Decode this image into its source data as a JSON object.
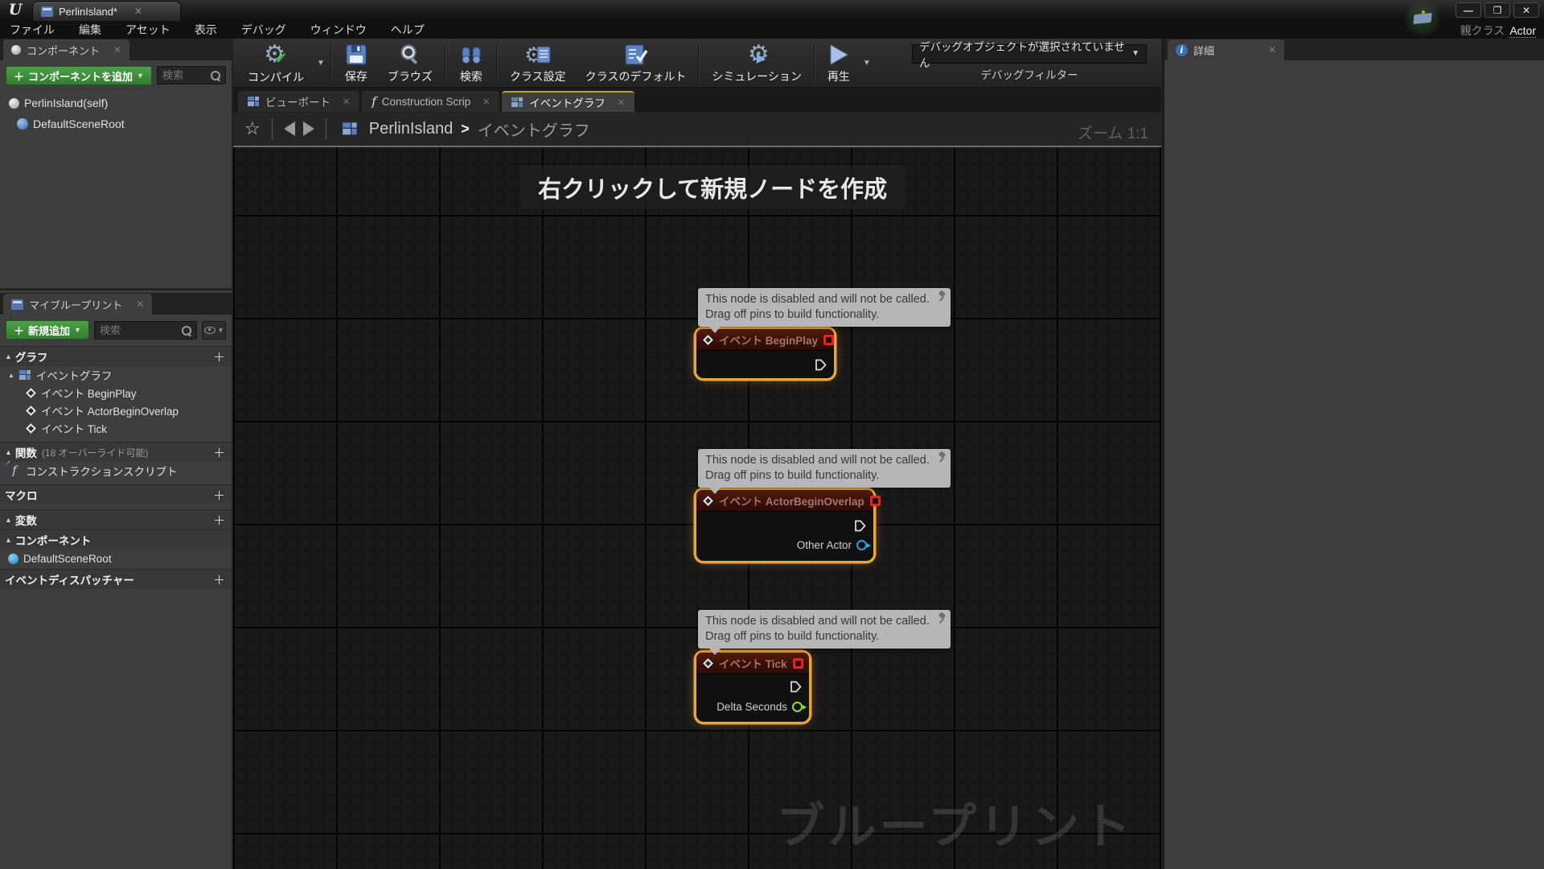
{
  "window": {
    "tab_title": "PerlinIsland*",
    "logo_glyph": "U"
  },
  "menu": {
    "items": [
      "ファイル",
      "編集",
      "アセット",
      "表示",
      "デバッグ",
      "ウィンドウ",
      "ヘルプ"
    ],
    "parent_class_label": "親クラス",
    "parent_class_value": "Actor"
  },
  "components_panel": {
    "tab_label": "コンポーネント",
    "add_button_label": "コンポーネントを追加",
    "search_placeholder": "検索",
    "items": [
      {
        "label": "PerlinIsland(self)"
      },
      {
        "label": "DefaultSceneRoot"
      }
    ]
  },
  "my_blueprint": {
    "tab_label": "マイブループリント",
    "add_button_label": "新規追加",
    "search_placeholder": "検索",
    "rows": {
      "graph_header": "グラフ",
      "event_graph": "イベントグラフ",
      "events": [
        "イベント BeginPlay",
        "イベント ActorBeginOverlap",
        "イベント Tick"
      ],
      "functions_header": "関数",
      "functions_note": "(18 オーバーライド可能)",
      "construction_script": "コンストラクションスクリプト",
      "macro_header": "マクロ",
      "variables_header": "変数",
      "components_header": "コンポーネント",
      "component_item": "DefaultSceneRoot",
      "dispatchers_header": "イベントディスパッチャー"
    }
  },
  "toolbar": {
    "buttons": [
      {
        "label": "コンパイル"
      },
      {
        "label": "保存"
      },
      {
        "label": "ブラウズ"
      },
      {
        "label": "検索"
      },
      {
        "label": "クラス設定"
      },
      {
        "label": "クラスのデフォルト"
      },
      {
        "label": "シミュレーション"
      },
      {
        "label": "再生"
      }
    ],
    "debug_dropdown_value": "デバッグオブジェクトが選択されていません",
    "debug_filter_label": "デバッグフィルター"
  },
  "doc_tabs": [
    {
      "label": "ビューポート"
    },
    {
      "label": "Construction Scrip"
    },
    {
      "label": "イベントグラフ"
    }
  ],
  "breadcrumb": {
    "root": "PerlinIsland",
    "separator": ">",
    "current": "イベントグラフ"
  },
  "graph": {
    "zoom_label": "ズーム 1:1",
    "hint": "右クリックして新規ノードを作成",
    "watermark": "ブループリント",
    "tooltip": {
      "line1": "This node is disabled and will not be called.",
      "line2": "Drag off pins to build functionality."
    },
    "nodes": [
      {
        "title": "イベント BeginPlay",
        "data_pins": []
      },
      {
        "title": "イベント ActorBeginOverlap",
        "data_pins": [
          "Other Actor"
        ]
      },
      {
        "title": "イベント Tick",
        "data_pins": [
          "Delta Seconds"
        ]
      }
    ],
    "accent_colors": {
      "selection": "#eba43b",
      "exec_pin": "#e0e0e0",
      "object_pin": "#2f9fdd",
      "float_pin": "#8ade3c",
      "disabled_header": "#551a10"
    }
  },
  "details_panel": {
    "tab_label": "詳細"
  }
}
